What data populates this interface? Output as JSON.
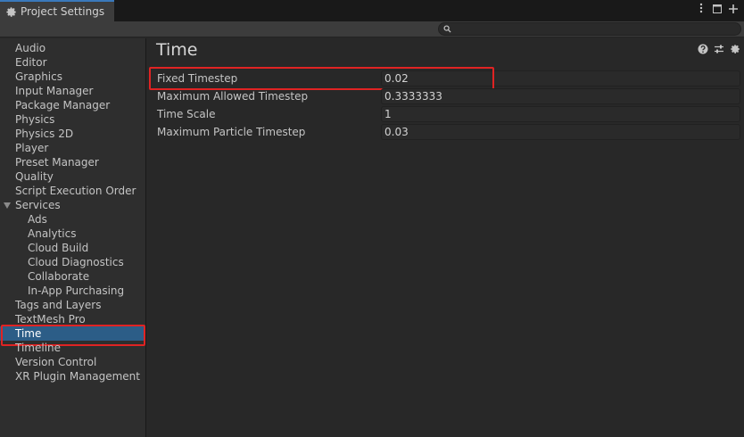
{
  "window": {
    "tab_title": "Project Settings",
    "tab_icon": "gear-icon",
    "controls": [
      "more-options-icon",
      "maximize-icon",
      "add-tab-icon"
    ]
  },
  "search": {
    "value": "",
    "placeholder": ""
  },
  "sidebar": {
    "items": [
      {
        "label": "Audio",
        "level": 0
      },
      {
        "label": "Editor",
        "level": 0
      },
      {
        "label": "Graphics",
        "level": 0
      },
      {
        "label": "Input Manager",
        "level": 0
      },
      {
        "label": "Package Manager",
        "level": 0
      },
      {
        "label": "Physics",
        "level": 0
      },
      {
        "label": "Physics 2D",
        "level": 0
      },
      {
        "label": "Player",
        "level": 0
      },
      {
        "label": "Preset Manager",
        "level": 0
      },
      {
        "label": "Quality",
        "level": 0
      },
      {
        "label": "Script Execution Order",
        "level": 0
      },
      {
        "label": "Services",
        "level": 0,
        "expanded": true
      },
      {
        "label": "Ads",
        "level": 1
      },
      {
        "label": "Analytics",
        "level": 1
      },
      {
        "label": "Cloud Build",
        "level": 1
      },
      {
        "label": "Cloud Diagnostics",
        "level": 1
      },
      {
        "label": "Collaborate",
        "level": 1
      },
      {
        "label": "In-App Purchasing",
        "level": 1
      },
      {
        "label": "Tags and Layers",
        "level": 0
      },
      {
        "label": "TextMesh Pro",
        "level": 0
      },
      {
        "label": "Time",
        "level": 0,
        "selected": true
      },
      {
        "label": "Timeline",
        "level": 0
      },
      {
        "label": "Version Control",
        "level": 0
      },
      {
        "label": "XR Plugin Management",
        "level": 0
      }
    ]
  },
  "main": {
    "title": "Time",
    "header_icons": [
      "help-icon",
      "presets-icon",
      "settings-gear-icon"
    ],
    "properties": [
      {
        "label": "Fixed Timestep",
        "value": "0.02",
        "highlighted": true
      },
      {
        "label": "Maximum Allowed Timestep",
        "value": "0.3333333"
      },
      {
        "label": "Time Scale",
        "value": "1"
      },
      {
        "label": "Maximum Particle Timestep",
        "value": "0.03"
      }
    ]
  },
  "colors": {
    "accent": "#3a79bb",
    "selection": "#2c5d87",
    "highlight_box": "#e02323",
    "panel_bg": "#282828",
    "sidebar_bg": "#2e2e2e"
  }
}
